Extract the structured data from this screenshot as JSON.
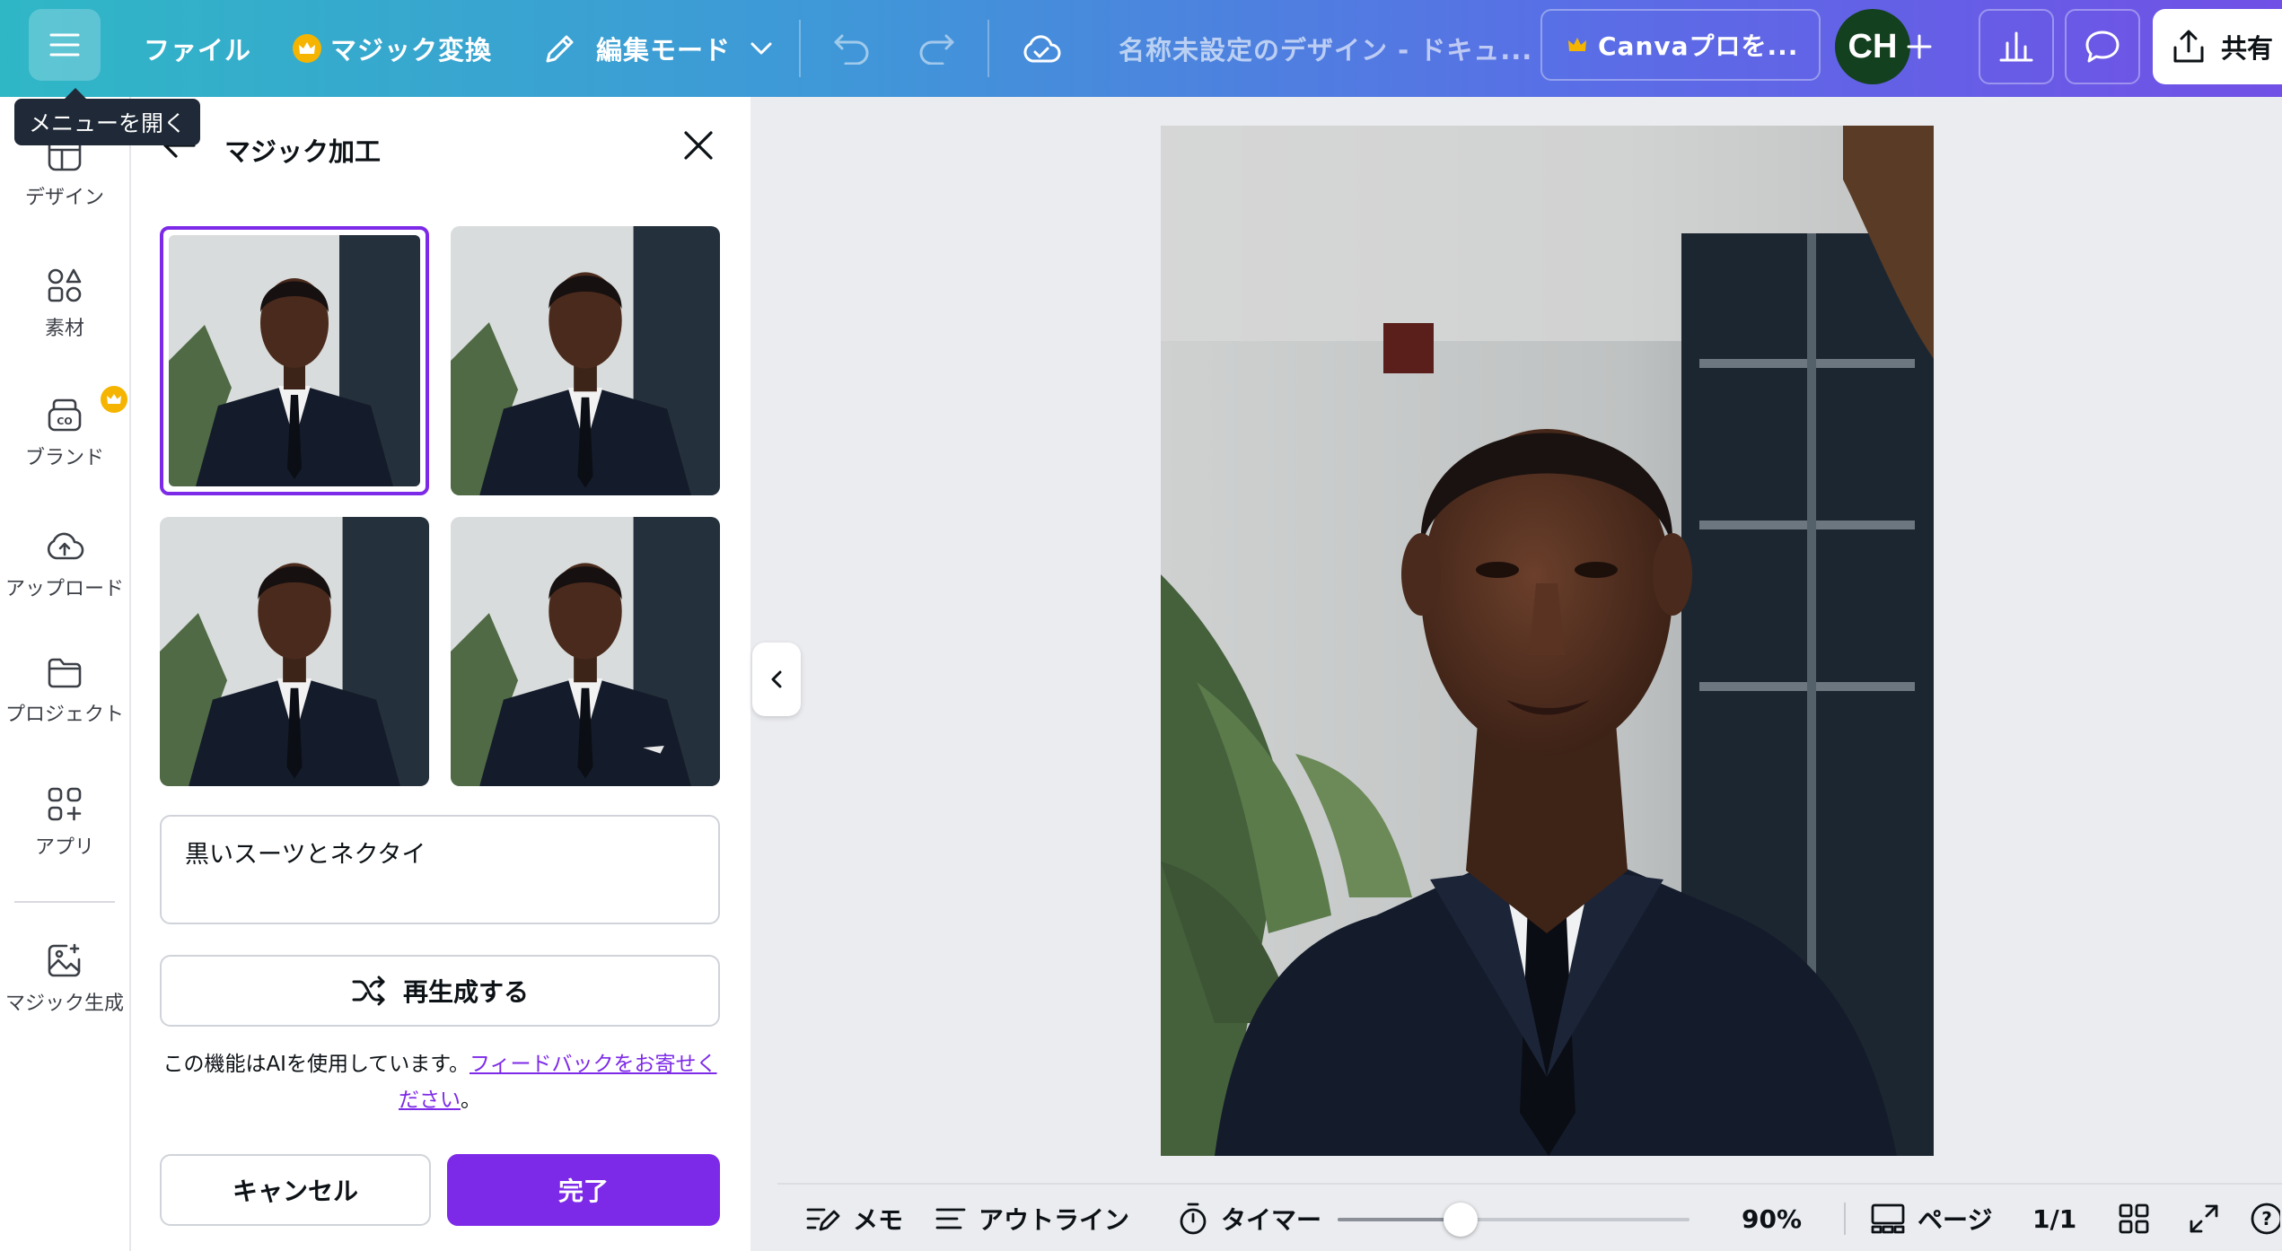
{
  "topbar": {
    "file_label": "ファイル",
    "magic_switch_label": "マジック変換",
    "edit_mode_label": "編集モード",
    "doc_title": "名称未設定のデザイン - ドキュ...",
    "pro_label": "Canvaプロを...",
    "avatar_initials": "CH",
    "share_label": "共有"
  },
  "tooltip": {
    "text": "メニューを開く"
  },
  "rail": {
    "items": [
      {
        "label": "デザイン",
        "icon": "design-icon"
      },
      {
        "label": "素材",
        "icon": "elements-icon"
      },
      {
        "label": "ブランド",
        "icon": "brand-icon"
      },
      {
        "label": "アップロード",
        "icon": "upload-icon"
      },
      {
        "label": "プロジェクト",
        "icon": "folder-icon"
      },
      {
        "label": "アプリ",
        "icon": "apps-icon"
      },
      {
        "label": "マジック生成",
        "icon": "magic-generate-icon"
      }
    ]
  },
  "panel": {
    "title": "マジック加工",
    "prompt_text": "黒いスーツとネクタイ",
    "regenerate_label": "再生成する",
    "ai_note_prefix": "この機能はAIを使用しています。",
    "feedback_link": "フィードバックをお寄せください",
    "ai_note_suffix": "。",
    "cancel_label": "キャンセル",
    "done_label": "完了",
    "selected_variant": 1
  },
  "bottombar": {
    "notes_label": "メモ",
    "outline_label": "アウトライン",
    "timer_label": "タイマー",
    "zoom_value": "90%",
    "zoom_fraction": 0.35,
    "pages_label": "ページ",
    "page_counter": "1/1"
  },
  "colors": {
    "accent": "#7d2ae8",
    "topbar_gradient_start": "#2fb7c6",
    "topbar_gradient_end": "#7150e6",
    "avatar_bg": "#13401f",
    "crown": "#f5b400"
  }
}
